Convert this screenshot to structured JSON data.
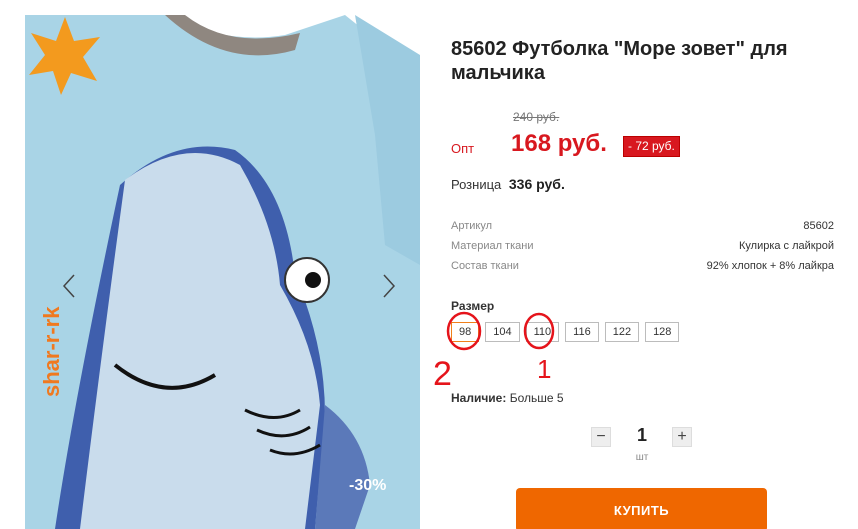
{
  "product": {
    "title": "85602 Футболка \"Море зовет\" для мальчика",
    "old_price": "240 руб.",
    "opt_label": "Опт",
    "opt_price": "168 руб.",
    "save_badge": "- 72 руб.",
    "retail_label": "Розница",
    "retail_price": "336 руб."
  },
  "specs": [
    {
      "key": "Артикул",
      "value": "85602"
    },
    {
      "key": "Материал ткани",
      "value": "Кулирка с лайкрой"
    },
    {
      "key": "Состав ткани",
      "value": "92% хлопок + 8% лайкра"
    }
  ],
  "sizes": {
    "label": "Размер",
    "options": [
      "98",
      "104",
      "110",
      "116",
      "122",
      "128"
    ],
    "selected": "98"
  },
  "stock": {
    "label": "Наличие:",
    "value": "Больше 5"
  },
  "quantity": {
    "value": "1",
    "unit": "шт",
    "minus": "−",
    "plus": "+"
  },
  "buy_button": "КУПИТЬ",
  "gallery": {
    "watermark": "shar-r-rk",
    "discount": "-30%",
    "prev_icon": "chevron-left-icon",
    "next_icon": "chevron-right-icon"
  },
  "annotations": {
    "mark_1": "1",
    "mark_2": "2"
  },
  "colors": {
    "accent": "#ef6700",
    "price_red": "#d8181f",
    "selected_border": "#f0801b"
  }
}
